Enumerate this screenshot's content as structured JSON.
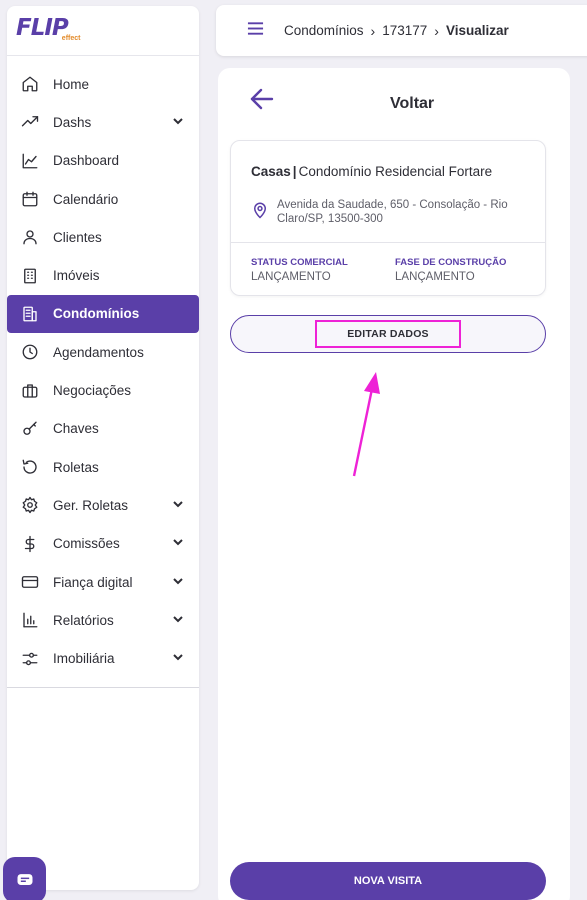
{
  "brand": {
    "logo": "FLIP",
    "sub": "effect"
  },
  "sidebar": {
    "items": [
      {
        "label": "Home",
        "icon": "home-icon",
        "chevron": false
      },
      {
        "label": "Dashs",
        "icon": "trending-up-icon",
        "chevron": true
      },
      {
        "label": "Dashboard",
        "icon": "line-chart-icon",
        "chevron": false
      },
      {
        "label": "Calendário",
        "icon": "calendar-icon",
        "chevron": false
      },
      {
        "label": "Clientes",
        "icon": "user-icon",
        "chevron": false
      },
      {
        "label": "Imóveis",
        "icon": "building-icon",
        "chevron": false
      },
      {
        "label": "Condomínios",
        "icon": "condo-icon",
        "chevron": false,
        "active": true
      },
      {
        "label": "Agendamentos",
        "icon": "clock-icon",
        "chevron": false
      },
      {
        "label": "Negociações",
        "icon": "briefcase-icon",
        "chevron": false
      },
      {
        "label": "Chaves",
        "icon": "key-icon",
        "chevron": false
      },
      {
        "label": "Roletas",
        "icon": "rotate-icon",
        "chevron": false
      },
      {
        "label": "Ger. Roletas",
        "icon": "gear-icon",
        "chevron": true
      },
      {
        "label": "Comissões",
        "icon": "dollar-icon",
        "chevron": true
      },
      {
        "label": "Fiança digital",
        "icon": "credit-card-icon",
        "chevron": true
      },
      {
        "label": "Relatórios",
        "icon": "bar-chart-icon",
        "chevron": true
      },
      {
        "label": "Imobiliária",
        "icon": "sliders-icon",
        "chevron": true
      }
    ]
  },
  "topbar": {
    "crumbs": [
      "Condomínios",
      "173177",
      "Visualizar"
    ]
  },
  "panel": {
    "back_label": "Voltar",
    "card": {
      "type": "Casas",
      "name": "Condomínio Residencial Fortare",
      "address": "Avenida da Saudade, 650 - Consolação - Rio Claro/SP, 13500-300",
      "status_label": "STATUS COMERCIAL",
      "status_value": "LANÇAMENTO",
      "phase_label": "FASE DE CONSTRUÇÃO",
      "phase_value": "LANÇAMENTO"
    },
    "edit_label": "EDITAR DADOS",
    "visit_label": "NOVA VISITA"
  },
  "colors": {
    "accent": "#5a3fa8",
    "highlight": "#ee22d6"
  }
}
